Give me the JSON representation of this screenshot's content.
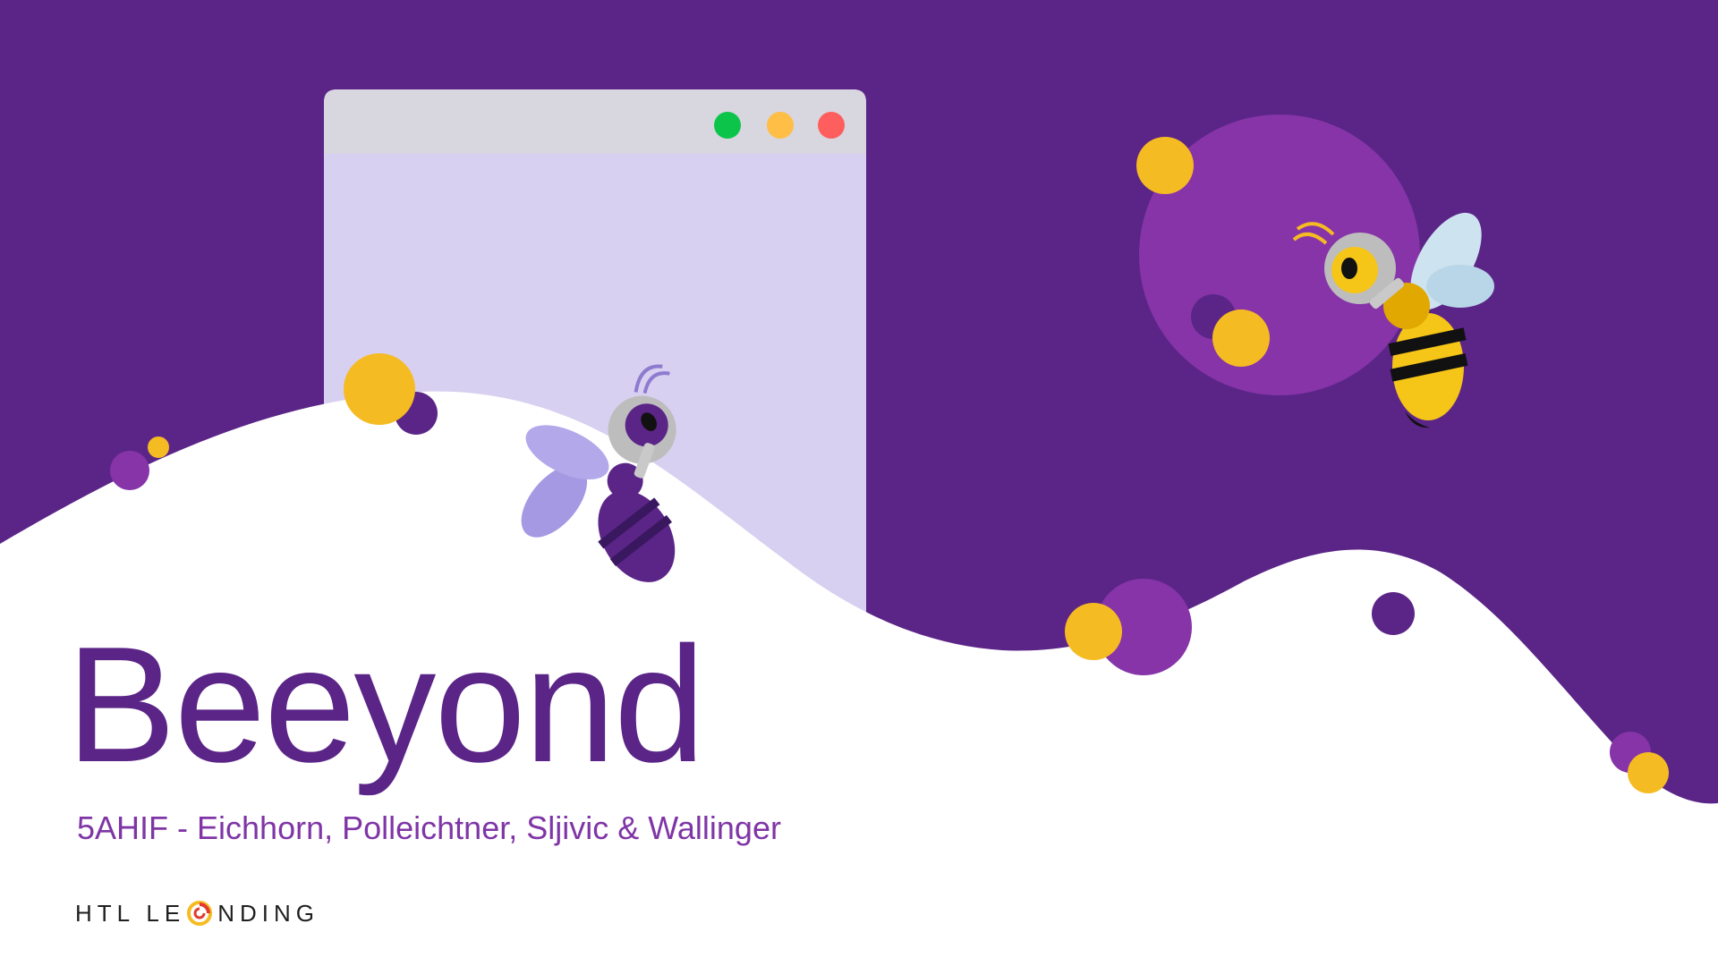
{
  "slide": {
    "title": "Beeyond",
    "subtitle": "5AHIF - Eichhorn, Polleichtner, Sljivic & Wallinger",
    "logo": {
      "part1": "HTL LE",
      "part2": "NDING",
      "icon": "swirl-logo-icon"
    }
  },
  "colors": {
    "background_purple": "#5b2588",
    "light_purple": "#d8d0f0",
    "accent_purple": "#8634a8",
    "yellow": "#f5bb22",
    "window_chrome": "#d8d6df",
    "traffic_green": "#0dc44a",
    "traffic_yellow": "#ffbe45",
    "traffic_red": "#ff5e5e",
    "title_text": "#5b2588",
    "subtitle_text": "#7f35a6"
  },
  "decorations": {
    "icons": [
      "browser-window-icon",
      "purple-bee-icon",
      "yellow-bee-icon"
    ]
  }
}
